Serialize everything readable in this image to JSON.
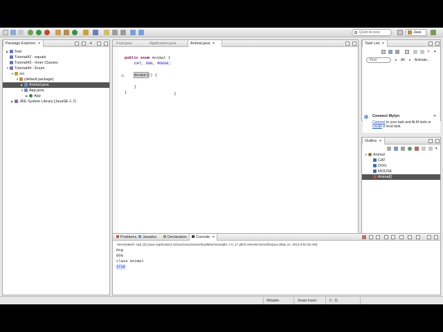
{
  "toolbar": {
    "quick_access_placeholder": "Quick Access",
    "perspective_label": "Java"
  },
  "package_explorer": {
    "tab_label": "Package Explorer",
    "items": [
      {
        "label": "Test",
        "color": "#6d6dcf"
      },
      {
        "label": "Tutorial42 - equals",
        "color": "#6d6dcf"
      },
      {
        "label": "Tutorial43 - Inner Classes",
        "color": "#6d6dcf"
      },
      {
        "label": "Tutorial44 - Enum",
        "color": "#6d6dcf"
      },
      {
        "label": "src",
        "color": "#c89a40"
      },
      {
        "label": "(default package)",
        "color": "#b58f4a"
      },
      {
        "label": "Animal.java",
        "color": "#6a8fd0"
      },
      {
        "label": "App.java",
        "color": "#6a8fd0"
      },
      {
        "label": "App",
        "color": "#2e8b57"
      },
      {
        "label": "JRE System Library [JavaSE-1.7]",
        "color": "#8a6ab0"
      }
    ]
  },
  "editor": {
    "tabs": [
      {
        "label": "Fruit.java"
      },
      {
        "label": "Application.java"
      },
      {
        "label": "Animal.java"
      }
    ],
    "code": {
      "line1_kw1": "public",
      "line1_kw2": "enum",
      "line1_rest": " Animal {",
      "line2_f1": "CAT",
      "line2_f2": "DOG",
      "line2_f3": "MOUSE",
      "line4_ctor": "Animal",
      "line4_rest": "() {",
      "line6": "}",
      "line7": "}"
    }
  },
  "task_list": {
    "tab_label": "Task List",
    "find_placeholder": "Find",
    "filter_all": "All",
    "filter_activate": "Activate..."
  },
  "connect_mylyn": {
    "title": "Connect Mylyn",
    "link1": "Connect",
    "text1": " to your task and ALM tools or ",
    "link2": "create",
    "text2": " a local task."
  },
  "outline": {
    "tab_label": "Outline",
    "items": [
      {
        "label": "Animal"
      },
      {
        "label": "CAT"
      },
      {
        "label": "DOG"
      },
      {
        "label": "MOUSE"
      },
      {
        "label": "Animal()"
      }
    ]
  },
  "bottom": {
    "tabs": [
      {
        "label": "Problems"
      },
      {
        "label": "Javadoc"
      },
      {
        "label": "Declaration"
      },
      {
        "label": "Console"
      }
    ],
    "console_header": "<terminated> App (3) [Java Application] /Library/Java/JavaVirtualMachines/jdk1.7.0_17.jdk/Contents/Home/bin/java (May 21, 2013 9:52:00 AM)",
    "console_lines": [
      "Dog",
      "DOG",
      "class Animal",
      "true"
    ]
  },
  "status": {
    "writable": "Writable",
    "insert_mode": "Smart Insert",
    "position": "5 : 11"
  },
  "colors": {
    "keyword": "#7f0055",
    "field": "#0000c0",
    "selection": "#555555"
  }
}
